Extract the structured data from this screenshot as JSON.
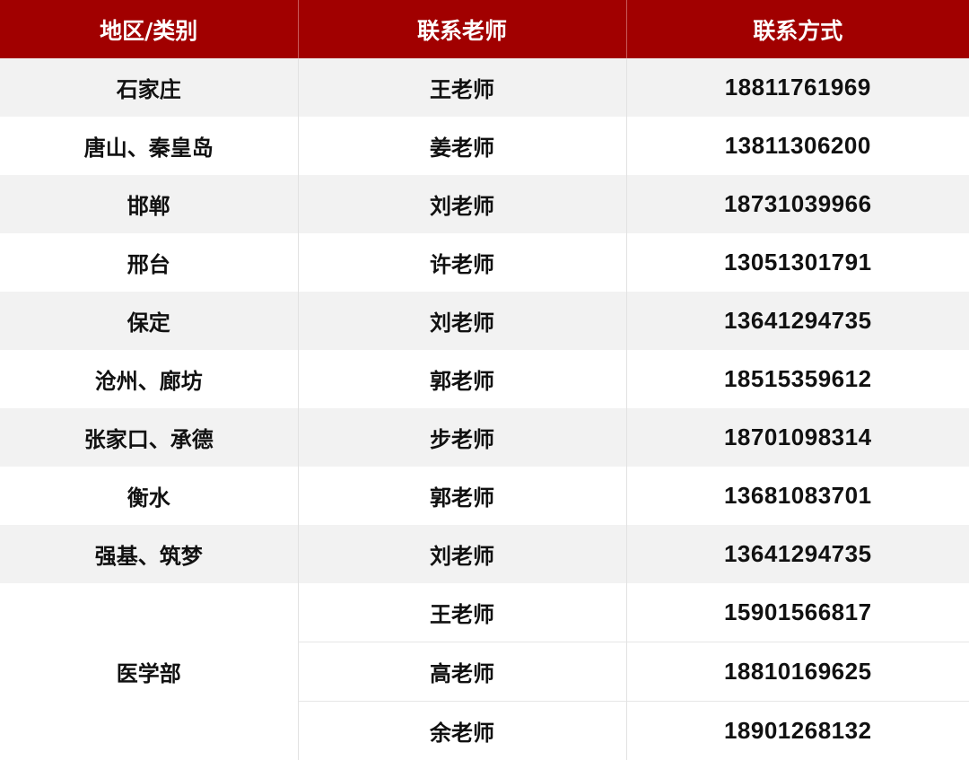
{
  "table": {
    "headers": [
      "地区/类别",
      "联系老师",
      "联系方式"
    ],
    "rows": [
      {
        "region": "石家庄",
        "teacher": "王老师",
        "phone": "18811761969"
      },
      {
        "region": "唐山、秦皇岛",
        "teacher": "姜老师",
        "phone": "13811306200"
      },
      {
        "region": "邯郸",
        "teacher": "刘老师",
        "phone": "18731039966"
      },
      {
        "region": "邢台",
        "teacher": "许老师",
        "phone": "13051301791"
      },
      {
        "region": "保定",
        "teacher": "刘老师",
        "phone": "13641294735"
      },
      {
        "region": "沧州、廊坊",
        "teacher": "郭老师",
        "phone": "18515359612"
      },
      {
        "region": "张家口、承德",
        "teacher": "步老师",
        "phone": "18701098314"
      },
      {
        "region": "衡水",
        "teacher": "郭老师",
        "phone": "13681083701"
      },
      {
        "region": "强基、筑梦",
        "teacher": "刘老师",
        "phone": "13641294735"
      }
    ],
    "medical": {
      "region": "医学部",
      "contacts": [
        {
          "teacher": "王老师",
          "phone": "15901566817"
        },
        {
          "teacher": "高老师",
          "phone": "18810169625"
        },
        {
          "teacher": "余老师",
          "phone": "18901268132"
        }
      ]
    },
    "colors": {
      "header_bg": "#a10000",
      "header_text": "#ffffff",
      "stripe_bg": "#f2f2f2"
    }
  }
}
